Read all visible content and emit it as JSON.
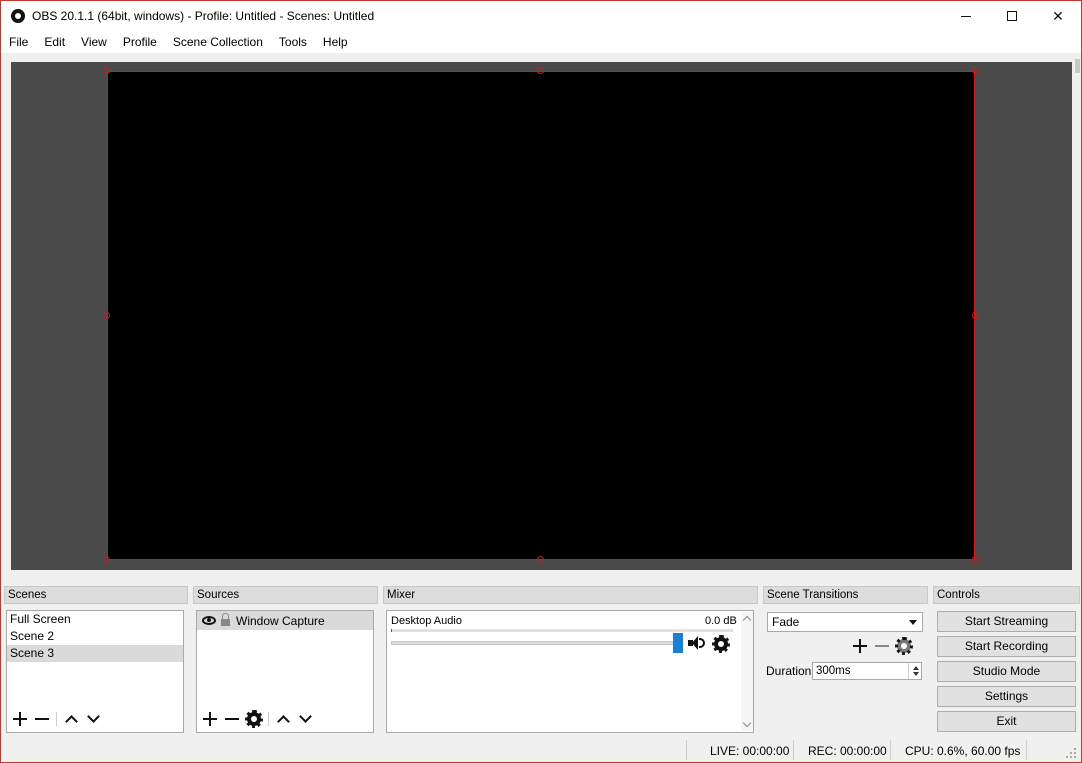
{
  "window": {
    "title": "OBS 20.1.1 (64bit, windows) - Profile: Untitled - Scenes: Untitled",
    "minimize": "Minimize",
    "maximize": "Maximize",
    "close": "✕"
  },
  "menu": [
    "File",
    "Edit",
    "View",
    "Profile",
    "Scene Collection",
    "Tools",
    "Help"
  ],
  "docks": {
    "scenes": {
      "title": "Scenes",
      "items": [
        "Full Screen",
        "Scene 2",
        "Scene 3"
      ],
      "selected": "Scene 3"
    },
    "sources": {
      "title": "Sources",
      "items": [
        {
          "name": "Window Capture",
          "visible": true,
          "locked": true
        }
      ]
    },
    "mixer": {
      "title": "Mixer",
      "channels": [
        {
          "name": "Desktop Audio",
          "level": "0.0 dB",
          "volume_fraction": 1.0
        }
      ]
    },
    "transitions": {
      "title": "Scene Transitions",
      "selected": "Fade",
      "duration_label": "Duration",
      "duration_value": "300ms"
    },
    "controls": {
      "title": "Controls",
      "buttons": [
        "Start Streaming",
        "Start Recording",
        "Studio Mode",
        "Settings",
        "Exit"
      ]
    }
  },
  "status": {
    "live": "LIVE: 00:00:00",
    "rec": "REC: 00:00:00",
    "cpu": "CPU: 0.6%, 60.00 fps"
  },
  "colors": {
    "selection_border": "#d0191b",
    "volume_accent": "#1c7fd6",
    "preview_bg": "#4a4a4a"
  },
  "icons": [
    "obs-logo-icon",
    "plus-icon",
    "minus-icon",
    "chevron-up-icon",
    "chevron-down-icon",
    "gear-icon",
    "eye-icon",
    "lock-icon",
    "speaker-icon"
  ]
}
